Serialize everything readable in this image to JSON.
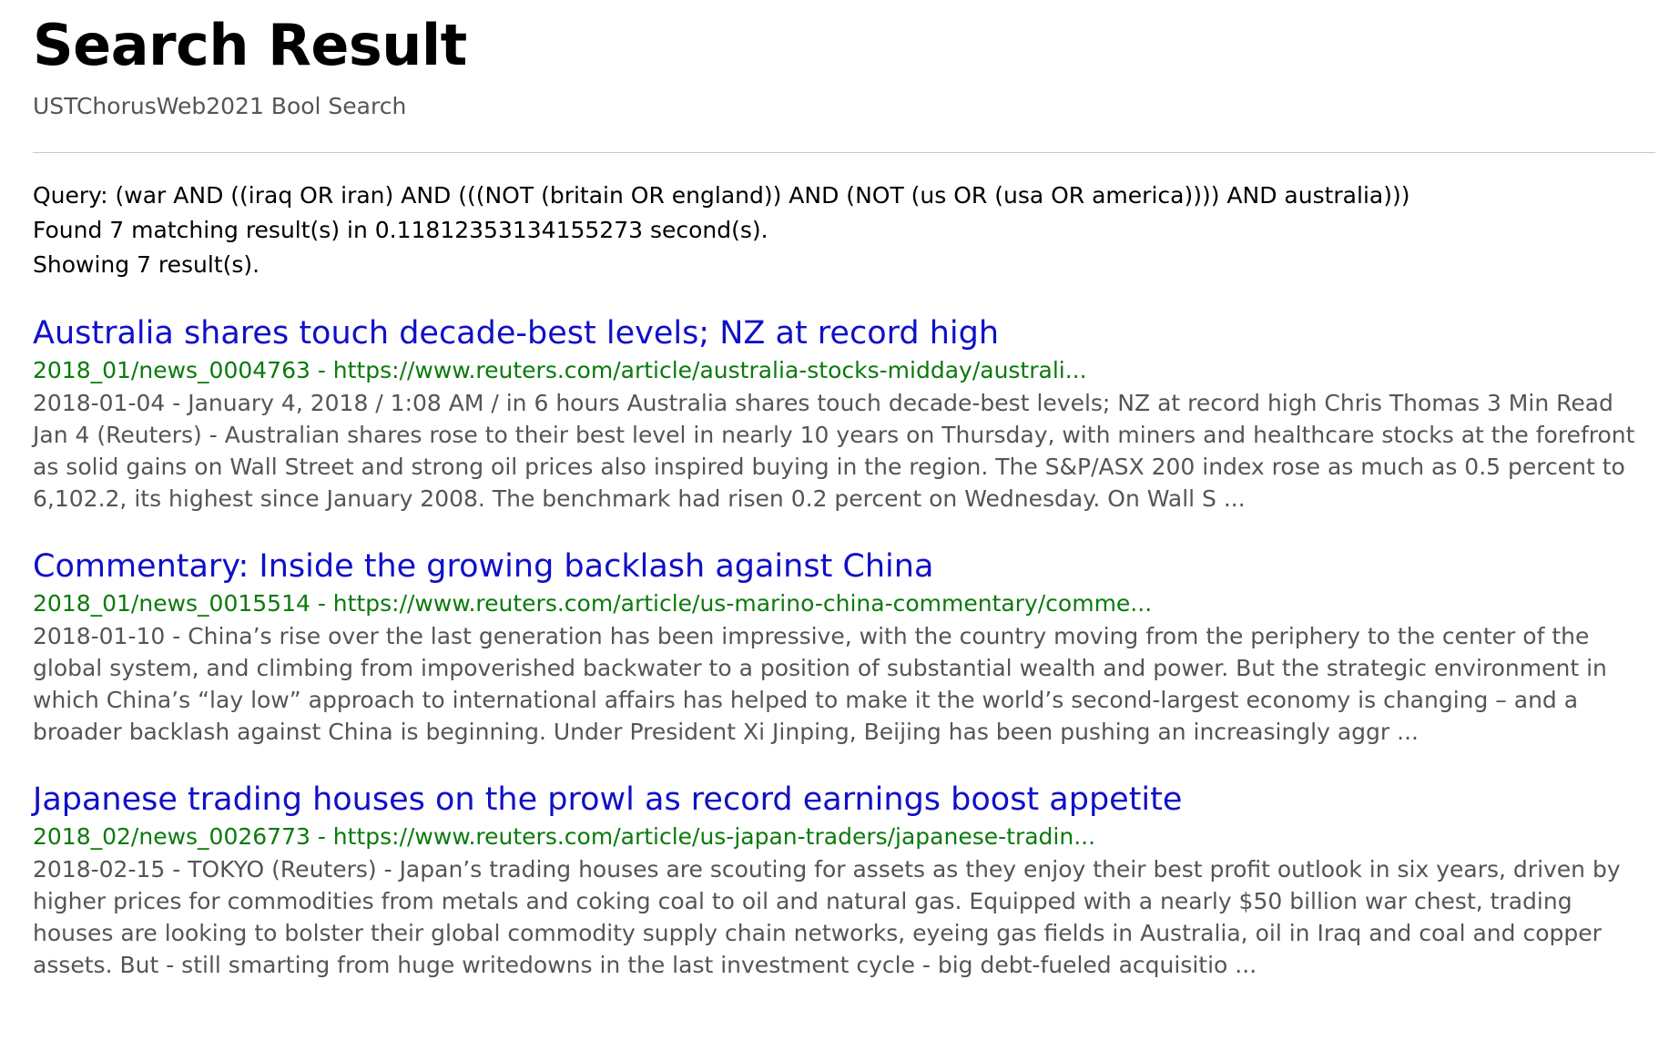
{
  "header": {
    "title": "Search Result",
    "subtitle": "USTChorusWeb2021 Bool Search"
  },
  "summary": {
    "query_line": "Query: (war AND ((iraq OR iran) AND (((NOT (britain OR england)) AND (NOT (us OR (usa OR america)))) AND australia)))",
    "found_line": "Found 7 matching result(s) in 0.11812353134155273 second(s).",
    "showing_line": "Showing 7 result(s)."
  },
  "results": [
    {
      "title": "Australia shares touch decade-best levels; NZ at record high",
      "url_line": "2018_01/news_0004763 - https://www.reuters.com/article/australia-stocks-midday/australi...",
      "snippet": "2018-01-04 - January 4, 2018 / 1:08 AM / in 6 hours Australia shares touch decade-best levels; NZ at record high Chris Thomas 3 Min Read Jan 4 (Reuters) - Australian shares rose to their best level in nearly 10 years on Thursday, with miners and healthcare stocks at the forefront as solid gains on Wall Street and strong oil prices also inspired buying in the region. The S&P/ASX 200 index rose as much as 0.5 percent to 6,102.2, its highest since January 2008. The benchmark had risen 0.2 percent on Wednesday. On Wall S ..."
    },
    {
      "title": "Commentary: Inside the growing backlash against China",
      "url_line": "2018_01/news_0015514 - https://www.reuters.com/article/us-marino-china-commentary/comme...",
      "snippet": "2018-01-10 - China’s rise over the last generation has been impressive, with the country moving from the periphery to the center of the global system, and climbing from impoverished backwater to a position of substantial wealth and power. But the strategic environment in which China’s “lay low” approach to international affairs has helped to make it the world’s second-largest economy is changing – and a broader backlash against China is beginning. Under President Xi Jinping, Beijing has been pushing an increasingly aggr ..."
    },
    {
      "title": "Japanese trading houses on the prowl as record earnings boost appetite",
      "url_line": "2018_02/news_0026773 - https://www.reuters.com/article/us-japan-traders/japanese-tradin...",
      "snippet": "2018-02-15 - TOKYO (Reuters) - Japan’s trading houses are scouting for assets as they enjoy their best profit outlook in six years, driven by higher prices for commodities from metals and coking coal to oil and natural gas. Equipped with a nearly $50 billion war chest, trading houses are looking to bolster their global commodity supply chain networks, eyeing gas fields in Australia, oil in Iraq and coal and copper assets. But - still smarting from huge writedowns in the last investment cycle - big debt-fueled acquisitio ..."
    }
  ]
}
